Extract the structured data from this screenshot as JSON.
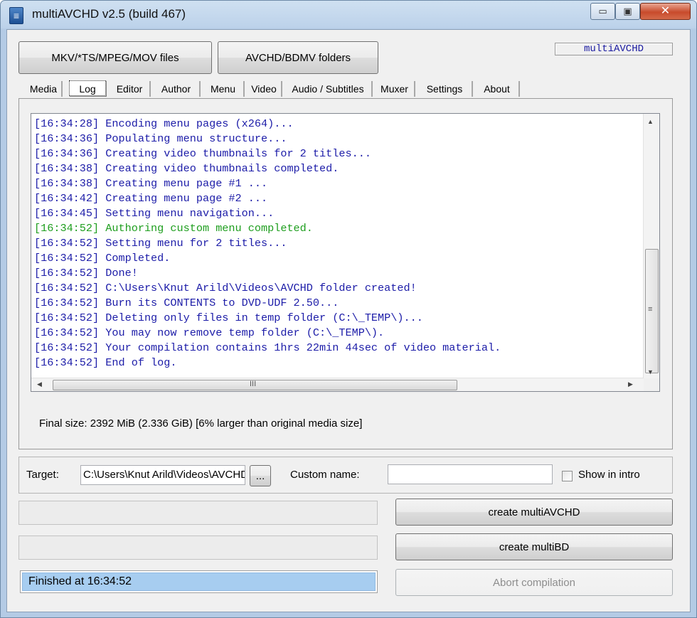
{
  "window": {
    "title": "multiAVCHD v2.5 (build 467)",
    "app_icon_glyph": "≡"
  },
  "title_buttons": {
    "minimize": "▭",
    "maximize": "▣",
    "close": "✕"
  },
  "source_buttons": {
    "files": "MKV/*TS/MPEG/MOV files",
    "folders": "AVCHD/BDMV folders"
  },
  "brand_label": "multiAVCHD",
  "tabs": [
    "Media",
    "Log",
    "Editor",
    "Author",
    "Menu",
    "Video",
    "Audio / Subtitles",
    "Muxer",
    "Settings",
    "About"
  ],
  "active_tab": "Log",
  "log": [
    {
      "text": "[16:34:28] Encoding menu pages (x264)...",
      "color": "#1c1ca8"
    },
    {
      "text": "[16:34:36] Populating menu structure...",
      "color": "#1c1ca8"
    },
    {
      "text": "[16:34:36] Creating video thumbnails for 2 titles...",
      "color": "#1c1ca8"
    },
    {
      "text": "[16:34:38] Creating video thumbnails completed.",
      "color": "#1c1ca8"
    },
    {
      "text": "[16:34:38] Creating menu page #1 ...",
      "color": "#1c1ca8"
    },
    {
      "text": "[16:34:42] Creating menu page #2 ...",
      "color": "#1c1ca8"
    },
    {
      "text": "[16:34:45] Setting menu navigation...",
      "color": "#1c1ca8"
    },
    {
      "text": "[16:34:52] Authoring custom menu completed.",
      "color": "#1e9e1e"
    },
    {
      "text": "[16:34:52] Setting menu for 2 titles...",
      "color": "#1c1ca8"
    },
    {
      "text": "[16:34:52] Completed.",
      "color": "#1c1ca8"
    },
    {
      "text": "[16:34:52] Done!",
      "color": "#1c1ca8"
    },
    {
      "text": "[16:34:52] C:\\Users\\Knut Arild\\Videos\\AVCHD folder created!",
      "color": "#1c1ca8"
    },
    {
      "text": "[16:34:52] Burn its CONTENTS to DVD-UDF 2.50...",
      "color": "#1c1ca8"
    },
    {
      "text": "[16:34:52] Deleting only files in temp folder (C:\\_TEMP\\)...",
      "color": "#1c1ca8"
    },
    {
      "text": "[16:34:52] You may now remove temp folder (C:\\_TEMP\\).",
      "color": "#1c1ca8"
    },
    {
      "text": "[16:34:52] Your compilation contains 1hrs 22min 44sec of video material.",
      "color": "#1c1ca8"
    },
    {
      "text": "[16:34:52] End of log.",
      "color": "#1c1ca8"
    }
  ],
  "final_size": "Final size: 2392 MiB (2.336 GiB) [6% larger than original media size]",
  "target": {
    "label": "Target:",
    "value": "C:\\Users\\Knut Arild\\Videos\\AVCHD",
    "browse": "...",
    "custom_name_label": "Custom name:",
    "custom_name_value": "",
    "show_in_intro": "Show in intro",
    "show_in_intro_checked": false
  },
  "actions": {
    "create_avchd": "create multiAVCHD",
    "create_bd": "create multiBD",
    "abort": "Abort compilation"
  },
  "status": "Finished at 16:34:52",
  "scroll_icons": {
    "up": "▲",
    "down": "▼",
    "left": "◀",
    "right": "▶",
    "grip_v": "≡",
    "grip_h": "III"
  }
}
